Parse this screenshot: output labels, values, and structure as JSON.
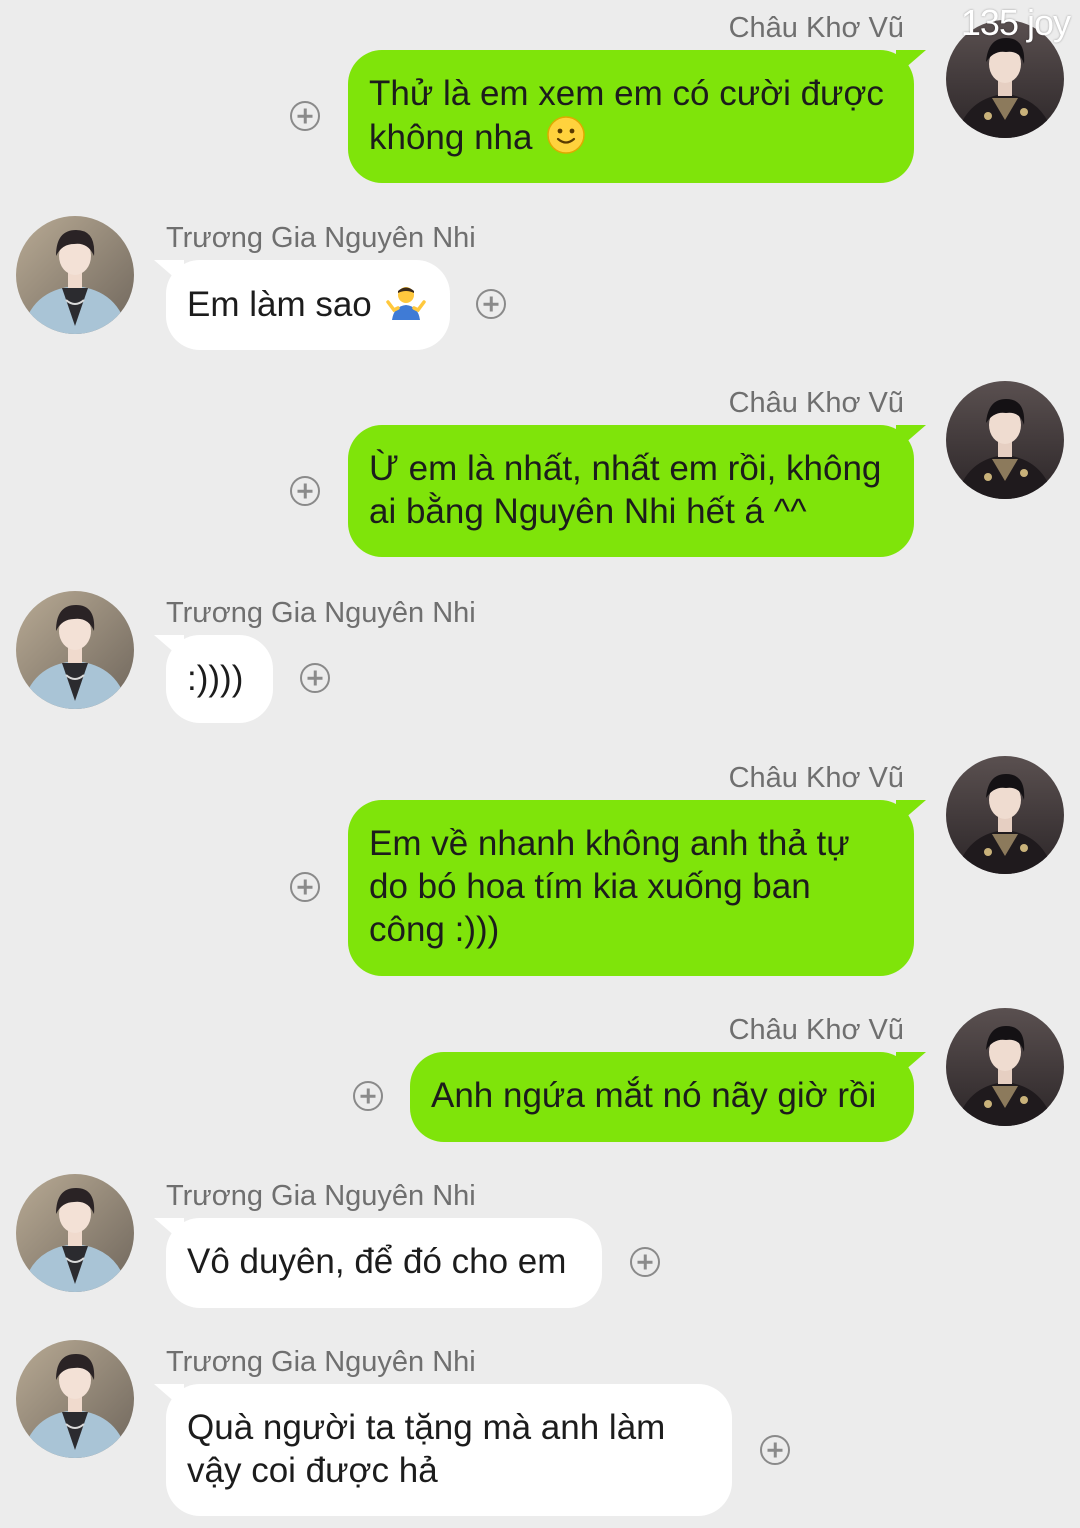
{
  "watermark": "135 joy",
  "contacts": {
    "self_name": "Châu Khơ Vũ",
    "other_name": "Trương Gia Nguyên Nhi"
  },
  "messages": [
    {
      "direction": "out",
      "sender": "Châu Khơ Vũ",
      "text": "Thử là em xem em có cười được không nha",
      "emoji": "slightly-smiling-face-icon"
    },
    {
      "direction": "in",
      "sender": "Trương Gia Nguyên Nhi",
      "text": "Em làm sao",
      "emoji": "person-shrugging-icon"
    },
    {
      "direction": "out",
      "sender": "Châu Khơ Vũ",
      "text": "Ừ em là nhất, nhất em rồi, không ai bằng Nguyên Nhi hết á ^^"
    },
    {
      "direction": "in",
      "sender": "Trương Gia Nguyên Nhi",
      "text": ":))))"
    },
    {
      "direction": "out",
      "sender": "Châu Khơ Vũ",
      "text": "Em về nhanh không anh thả tự do bó hoa tím kia xuống ban công :)))"
    },
    {
      "direction": "out",
      "sender": "Châu Khơ Vũ",
      "text": "Anh ngứa mắt nó nãy giờ rồi"
    },
    {
      "direction": "in",
      "sender": "Trương Gia Nguyên Nhi",
      "text": "Vô duyên, để đó cho em"
    },
    {
      "direction": "in",
      "sender": "Trương Gia Nguyên Nhi",
      "text": "Quà người ta tặng mà anh làm vậy coi được hả"
    }
  ],
  "colors": {
    "background": "#ececec",
    "outgoing_bubble": "#7fe40a",
    "incoming_bubble": "#ffffff",
    "name_text": "#6f6f6f"
  },
  "icons": {
    "react_button": "add-reaction-icon",
    "avatar_self": "avatar-dark-outfit",
    "avatar_other": "avatar-light-blue-suit"
  }
}
